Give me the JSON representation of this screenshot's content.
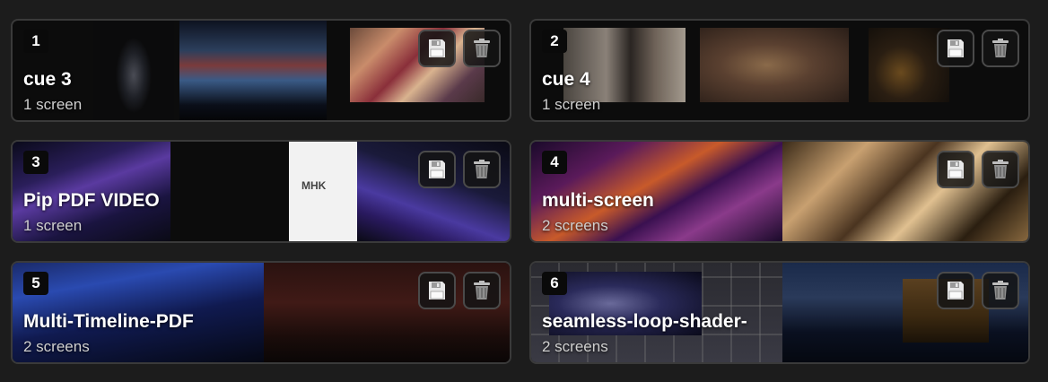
{
  "cues": [
    {
      "number": "1",
      "title": "cue 3",
      "screens": "1 screen"
    },
    {
      "number": "2",
      "title": "cue 4",
      "screens": "1 screen"
    },
    {
      "number": "3",
      "title": "Pip PDF VIDEO",
      "screens": "1 screen",
      "pdf_logo": "MHK"
    },
    {
      "number": "4",
      "title": "multi-screen",
      "screens": "2 screens"
    },
    {
      "number": "5",
      "title": "Multi-Timeline-PDF",
      "screens": "2 screens"
    },
    {
      "number": "6",
      "title": "seamless-loop-shader-",
      "screens": "2 screens"
    }
  ],
  "icons": {
    "save": "floppy-disk-icon",
    "delete": "trash-can-icon"
  },
  "colors": {
    "background": "#1c1c1c",
    "card_border": "#3a3a3a",
    "text": "#ffffff",
    "subtext": "#cfcfcf"
  }
}
